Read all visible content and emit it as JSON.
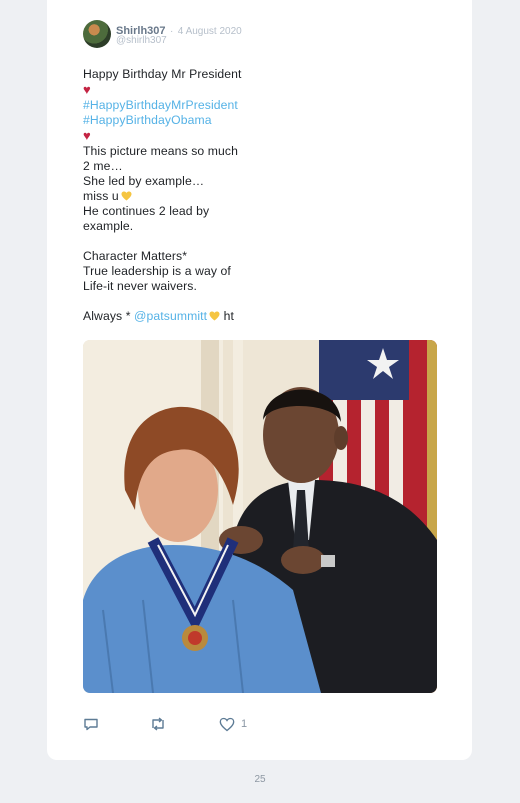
{
  "tweet": {
    "author_name": "Shirlh307",
    "separator": "·",
    "date": "4 August 2020",
    "handle": "@shirlh307",
    "lines": {
      "l1": "Happy Birthday Mr President",
      "l2_tag": "#HappyBirthdayMrPresident",
      "l3_tag": "#HappyBirthdayObama",
      "l4": "This picture means so much",
      "l5": "2 me…",
      "l6": "She led by example…",
      "l7": "miss u",
      "l8": "He continues 2 lead by",
      "l9": "example.",
      "l10": "Character Matters*",
      "l11": "True leadership is a way of",
      "l12": "Life-it never waivers.",
      "l13_a": "Always * ",
      "l13_mention": "@patsummitt",
      "l13_b": " ht"
    },
    "like_count": "1"
  },
  "icons": {
    "reply": "reply-icon",
    "retweet": "retweet-icon",
    "like": "heart-icon",
    "red_heart": "red-heart-emoji",
    "yellow_heart": "yellow-heart-emoji"
  },
  "colors": {
    "hashtag": "#55b2e6",
    "red_heart": "#c42443",
    "yellow_heart": "#f5c542",
    "page_bg": "#eef0f3"
  },
  "footer": {
    "page_number": "25"
  }
}
